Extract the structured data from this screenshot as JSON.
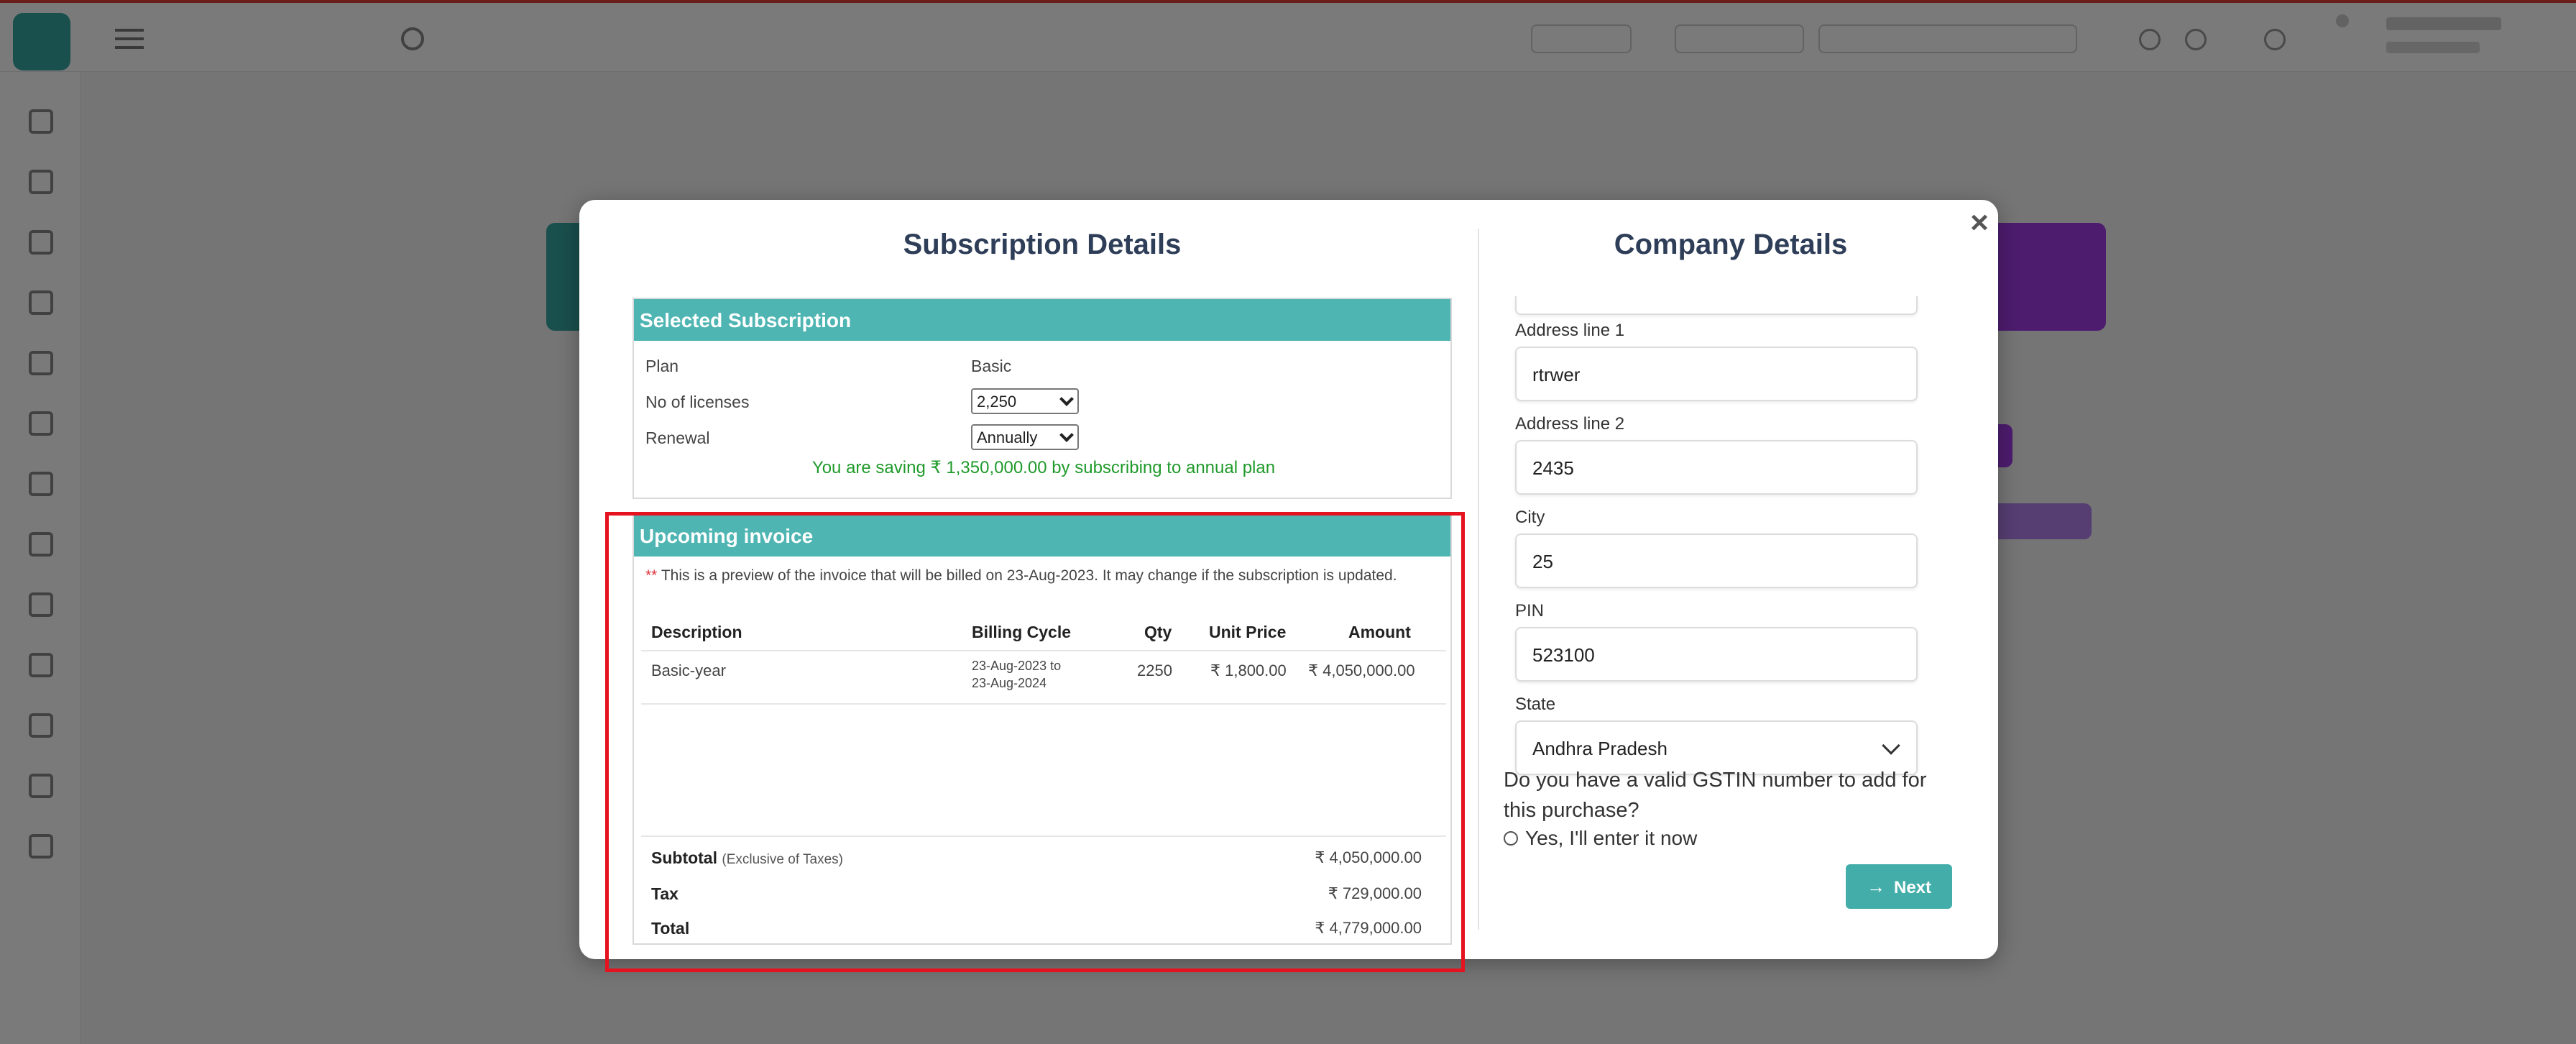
{
  "modal": {
    "close_label": "×",
    "subscription": {
      "title": "Subscription Details",
      "selected_header": "Selected Subscription",
      "plan_label": "Plan",
      "plan_value": "Basic",
      "licenses_label": "No of licenses",
      "licenses_value": "2,250",
      "renewal_label": "Renewal",
      "renewal_value": "Annually",
      "saving_text": "You are saving ₹ 1,350,000.00 by subscribing to annual plan"
    },
    "invoice": {
      "header": "Upcoming invoice",
      "note_star": "**",
      "note_text": "This is a preview of the invoice that will be billed on 23-Aug-2023. It may change if the subscription is updated.",
      "columns": [
        "Description",
        "Billing Cycle",
        "Qty",
        "Unit Price",
        "Amount"
      ],
      "rows": [
        {
          "description": "Basic-year",
          "billing_cycle_1": "23-Aug-2023 to",
          "billing_cycle_2": "23-Aug-2024",
          "qty": "2250",
          "unit_price": "₹ 1,800.00",
          "amount": "₹ 4,050,000.00"
        }
      ],
      "subtotal_label": "Subtotal",
      "subtotal_note": "(Exclusive of Taxes)",
      "subtotal_value": "₹ 4,050,000.00",
      "tax_label": "Tax",
      "tax_value": "₹ 729,000.00",
      "total_label": "Total",
      "total_value": "₹ 4,779,000.00"
    },
    "company": {
      "title": "Company Details",
      "address1_label": "Address line 1",
      "address1_value": "rtrwer",
      "address2_label": "Address line 2",
      "address2_value": "2435",
      "city_label": "City",
      "city_value": "25",
      "pin_label": "PIN",
      "pin_value": "523100",
      "state_label": "State",
      "state_value": "Andhra Pradesh",
      "gstin_question": "Do you have a valid GSTIN number to add for this purchase?",
      "gstin_option": "Yes, I'll enter it now",
      "next_label": "Next"
    }
  },
  "colors": {
    "accent": "#4eb5b3",
    "heading": "#2f3e58",
    "saving": "#1f9a2a",
    "highlight": "#e5131f"
  },
  "icons": {
    "close": "close-icon",
    "next": "arrow-right-icon",
    "state_dropdown": "chevron-down-icon"
  }
}
